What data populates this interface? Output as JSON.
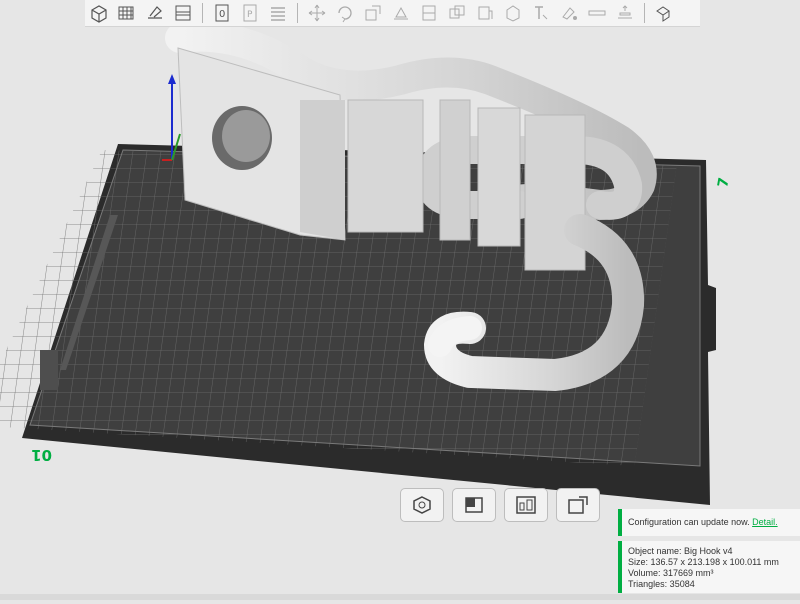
{
  "app": {
    "toolbar": [
      {
        "icon": "add-cube-icon"
      },
      {
        "icon": "add-plate-icon"
      },
      {
        "icon": "auto-orient-icon"
      },
      {
        "icon": "arrange-icon"
      },
      {
        "icon": "plate-number-icon"
      },
      {
        "icon": "split-objects-icon"
      },
      {
        "icon": "layers-icon"
      },
      {
        "icon": "move-icon"
      },
      {
        "icon": "rotate-icon"
      },
      {
        "icon": "scale-icon"
      },
      {
        "icon": "lay-on-face-icon"
      },
      {
        "icon": "cut-icon"
      },
      {
        "icon": "boolean-icon"
      },
      {
        "icon": "support-paint-icon"
      },
      {
        "icon": "seam-paint-icon"
      },
      {
        "icon": "text-icon"
      },
      {
        "icon": "color-paint-icon"
      },
      {
        "icon": "measure-icon"
      },
      {
        "icon": "assembly-icon"
      },
      {
        "icon": "variable-layer-icon"
      }
    ],
    "plate": {
      "label_left": "01",
      "label_right": "7"
    },
    "view_buttons": [
      {
        "icon": "orient-view-icon"
      },
      {
        "icon": "object-view-icon"
      },
      {
        "icon": "arrange-view-icon"
      },
      {
        "icon": "auto-rotate-view-icon"
      }
    ],
    "notifications": {
      "update_text": "Configuration can update now.",
      "update_link": "Detail.",
      "object_name": "Object name: Big Hook v4",
      "size": "Size: 136.57 x 213.198 x 100.011 mm",
      "volume": "Volume: 317669 mm³",
      "triangles": "Triangles: 35084"
    },
    "colors": {
      "accent": "#00ae42",
      "plate": "#3f3f3f",
      "grid": "#6e6e6e",
      "model": "#dcdcdc"
    }
  }
}
